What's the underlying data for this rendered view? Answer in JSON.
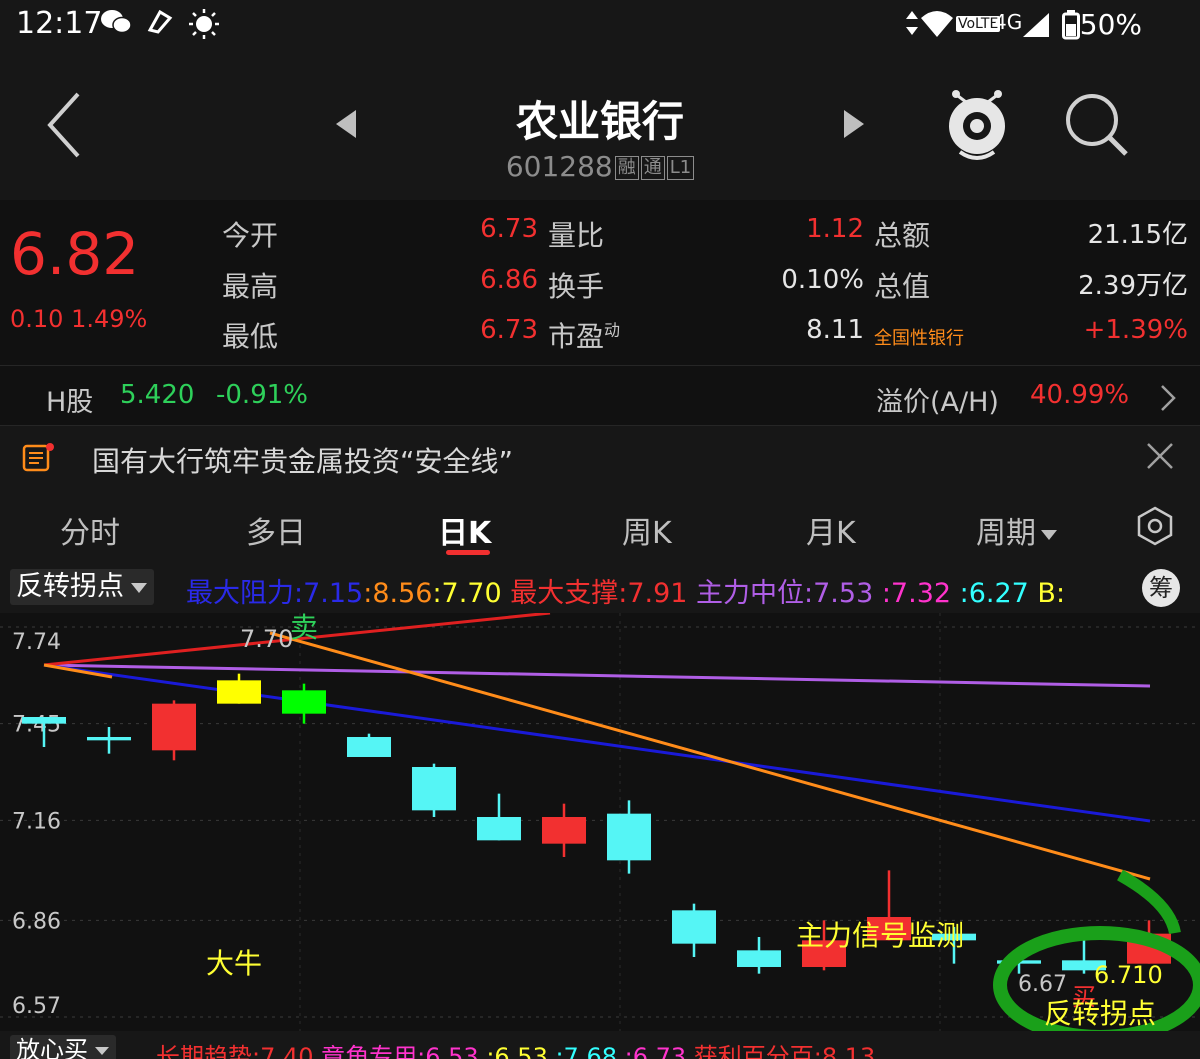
{
  "status_bar": {
    "time": "12:17",
    "network": "VoLTE",
    "network_type": "4G",
    "battery": "50%"
  },
  "header": {
    "title": "农业银行",
    "code": "601288",
    "tags": [
      "融",
      "通",
      "L1"
    ]
  },
  "quote": {
    "price": "6.82",
    "change": "0.10",
    "change_pct": "1.49%",
    "rows": [
      {
        "l1": "今开",
        "v1": "6.73",
        "l2": "量比",
        "v2": "1.12",
        "l3": "总额",
        "v3": "21.15亿"
      },
      {
        "l1": "最高",
        "v1": "6.86",
        "l2": "换手",
        "v2": "0.10%",
        "l3": "总值",
        "v3": "2.39万亿"
      },
      {
        "l1": "最低",
        "v1": "6.73",
        "l2": "市盈",
        "l2_sup": "动",
        "v2": "8.11",
        "l3": "全国性银行",
        "v3": "+1.39%"
      }
    ]
  },
  "hshare": {
    "label": "H股",
    "price": "5.420",
    "change": "-0.91%",
    "premium_label": "溢价(A/H)",
    "premium": "40.99%"
  },
  "news": {
    "text": "国有大行筑牢贵金属投资“安全线”"
  },
  "tabs": {
    "items": [
      "分时",
      "多日",
      "日K",
      "周K",
      "月K",
      "周期"
    ],
    "active": "日K"
  },
  "indicator": {
    "name": "反转拐点",
    "chip": "筹",
    "segments": [
      {
        "text": "最大阻力:7.15",
        "color": "#2a2ae8"
      },
      {
        "text": ":8.56",
        "color": "#ff8c1a"
      },
      {
        "text": ":7.70",
        "color": "#ffff33"
      },
      {
        "text": " 最大支撑:7.91",
        "color": "#f23030"
      },
      {
        "text": " 主力中位:7.53",
        "color": "#b05ee6"
      },
      {
        "text": " :7.32",
        "color": "#ff33cc"
      },
      {
        "text": " :6.27",
        "color": "#33ffff"
      },
      {
        "text": " B:",
        "color": "#ffff33"
      }
    ]
  },
  "chart": {
    "y_ticks": [
      "7.74",
      "7.45",
      "7.16",
      "6.86",
      "6.57"
    ],
    "annotations": {
      "price_top": "7.70",
      "sell_mark": "卖",
      "bull": "大牛",
      "signal": "主力信号监测",
      "low_left": "6.67",
      "low_right": "6.710",
      "buy_mark": "买",
      "reversal": "反转拐点"
    },
    "colors": {
      "up": "#f23030",
      "down": "#55f5f5",
      "yellow": "#ffff00",
      "green": "#00ff00"
    }
  },
  "chart_data": {
    "type": "candlestick",
    "ylim": [
      6.57,
      7.74
    ],
    "candles": [
      {
        "open": 7.47,
        "close": 7.45,
        "high": 7.47,
        "low": 7.38,
        "color": "down"
      },
      {
        "open": 7.41,
        "close": 7.4,
        "high": 7.44,
        "low": 7.36,
        "color": "down"
      },
      {
        "open": 7.37,
        "close": 7.51,
        "high": 7.52,
        "low": 7.34,
        "color": "up"
      },
      {
        "open": 7.51,
        "close": 7.58,
        "high": 7.6,
        "low": 7.51,
        "color": "up"
      },
      {
        "open": 7.48,
        "close": 7.55,
        "high": 7.57,
        "low": 7.45,
        "color": "down"
      },
      {
        "open": 7.41,
        "close": 7.35,
        "high": 7.42,
        "low": 7.35,
        "color": "down"
      },
      {
        "open": 7.32,
        "close": 7.19,
        "high": 7.33,
        "low": 7.17,
        "color": "down"
      },
      {
        "open": 7.17,
        "close": 7.1,
        "high": 7.24,
        "low": 7.1,
        "color": "down"
      },
      {
        "open": 7.09,
        "close": 7.17,
        "high": 7.21,
        "low": 7.05,
        "color": "up"
      },
      {
        "open": 7.18,
        "close": 7.04,
        "high": 7.22,
        "low": 7.0,
        "color": "down"
      },
      {
        "open": 6.89,
        "close": 6.79,
        "high": 6.91,
        "low": 6.75,
        "color": "down"
      },
      {
        "open": 6.77,
        "close": 6.72,
        "high": 6.81,
        "low": 6.7,
        "color": "down"
      },
      {
        "open": 6.72,
        "close": 6.8,
        "high": 6.86,
        "low": 6.71,
        "color": "up"
      },
      {
        "open": 6.8,
        "close": 6.87,
        "high": 7.01,
        "low": 6.8,
        "color": "up"
      },
      {
        "open": 6.82,
        "close": 6.8,
        "high": 6.84,
        "low": 6.73,
        "color": "down"
      },
      {
        "open": 6.74,
        "close": 6.73,
        "high": 6.76,
        "low": 6.7,
        "color": "down"
      },
      {
        "open": 6.74,
        "close": 6.71,
        "high": 6.81,
        "low": 6.7,
        "color": "down"
      },
      {
        "open": 6.73,
        "close": 6.82,
        "high": 6.86,
        "low": 6.73,
        "color": "up"
      }
    ]
  },
  "bottom_bar": {
    "name": "放心买",
    "segments": [
      {
        "text": "长期趋势:7.40",
        "color": "#f23030"
      },
      {
        "text": " 竟角专用:6.53",
        "color": "#ff33cc"
      },
      {
        "text": " :6.53",
        "color": "#ffff33"
      },
      {
        "text": " :7.68",
        "color": "#33ffff"
      },
      {
        "text": " :6.73",
        "color": "#ff33cc"
      },
      {
        "text": " 获利百分百:8.13",
        "color": "#f23030"
      }
    ]
  }
}
